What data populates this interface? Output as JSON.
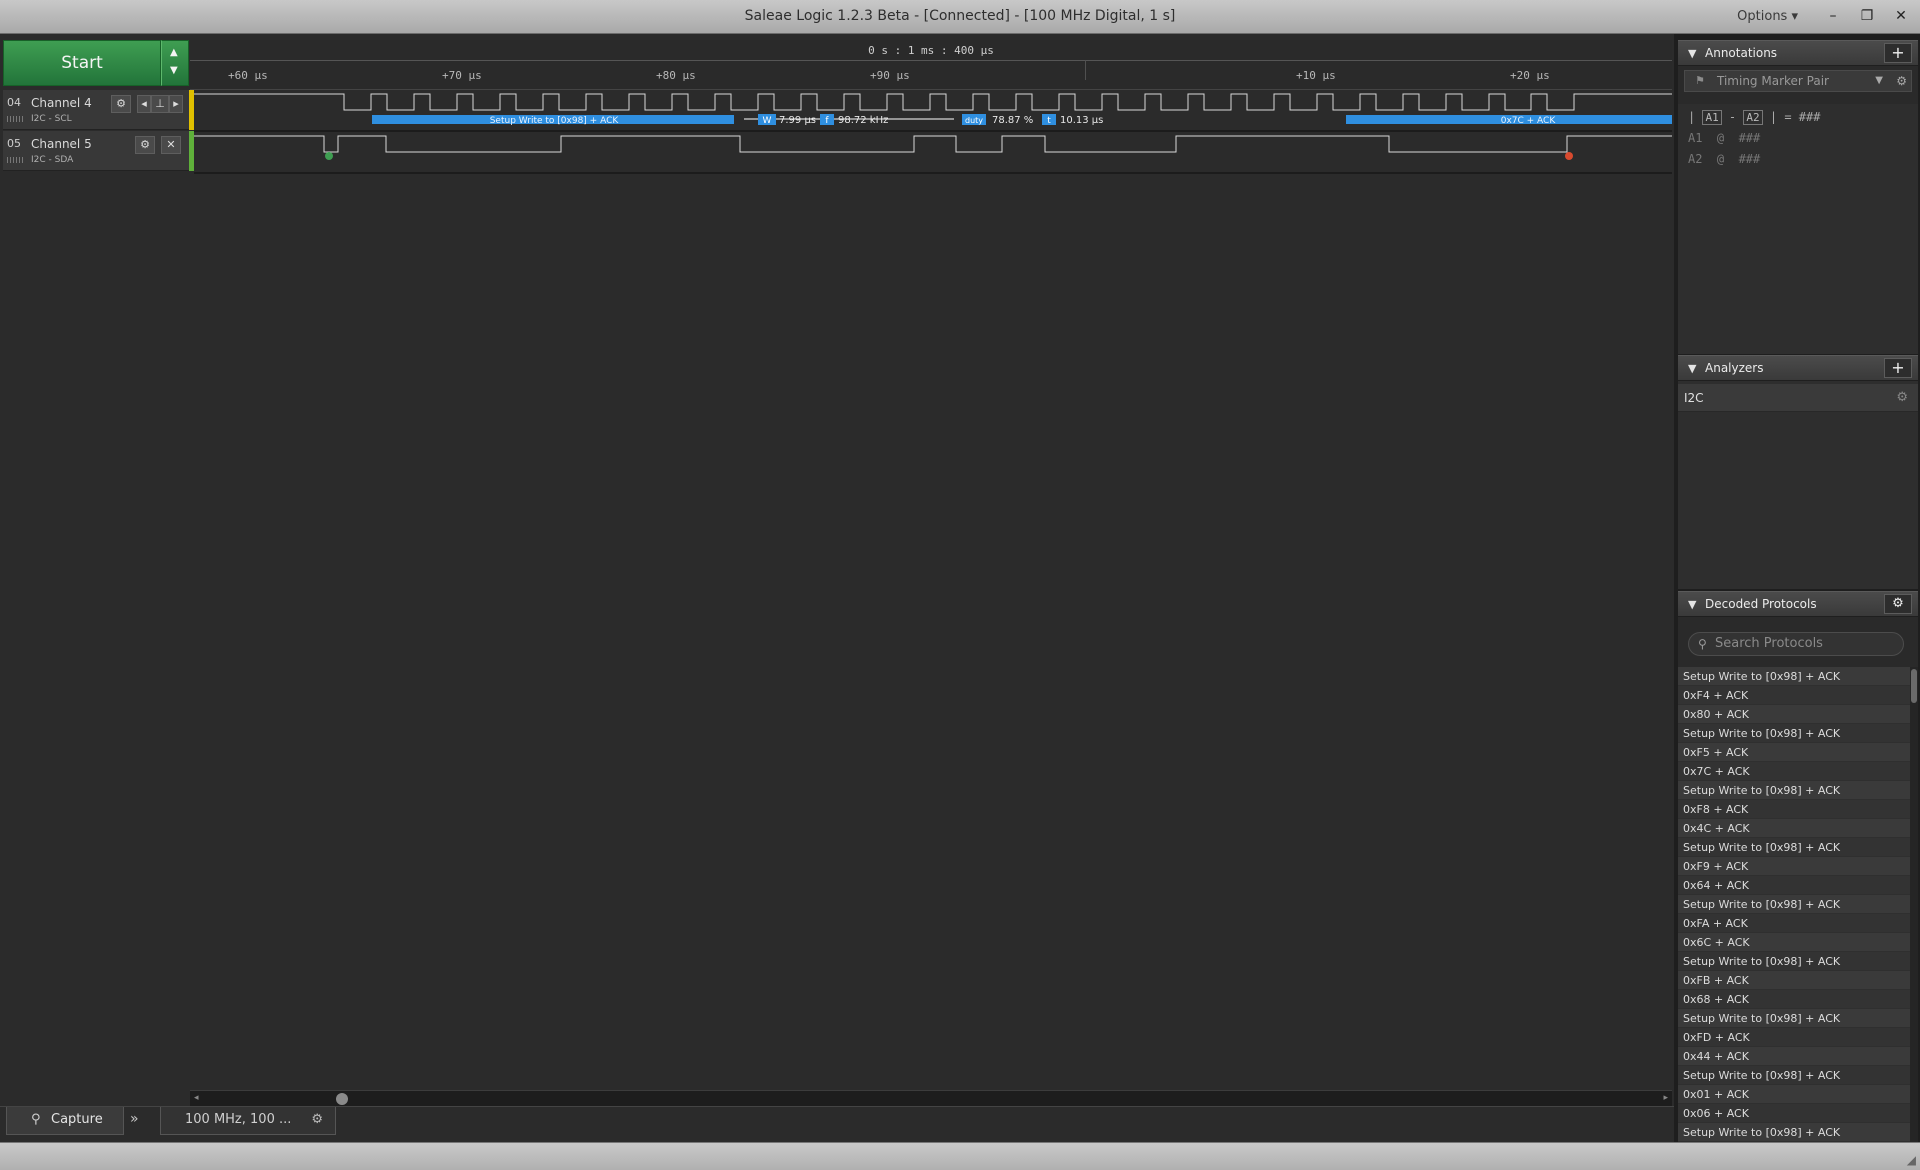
{
  "window": {
    "title": "Saleae Logic 1.2.3 Beta - [Connected] - [100 MHz Digital, 1 s]",
    "options_label": "Options ▾",
    "minimize_glyph": "–",
    "maximize_glyph": "❐",
    "close_glyph": "✕"
  },
  "toolbar": {
    "start_label": "Start",
    "up_glyph": "▲",
    "down_glyph": "▼"
  },
  "timeline": {
    "center_label": "0 s : 1 ms : 400 μs",
    "ticks": [
      "+60 μs",
      "+70 μs",
      "+80 μs",
      "+90 μs",
      "+10 μs",
      "+20 μs"
    ]
  },
  "channels": [
    {
      "num": "04",
      "name": "Channel 4",
      "sub": "I2C - SCL",
      "color": "#e0c000"
    },
    {
      "num": "05",
      "name": "Channel 5",
      "sub": "I2C - SDA",
      "color": "#5fb03a"
    }
  ],
  "measurements": {
    "width_tag": "W",
    "width_value": "7.99 μs",
    "freq_tag": "f",
    "freq_value": "98.72 kHz",
    "duty_tag": "duty",
    "duty_value": "78.87 %",
    "period_tag": "t",
    "period_value": "10.13 μs"
  },
  "decodes": {
    "first": "Setup Write to [0x98] + ACK",
    "second": "0x7C + ACK"
  },
  "bottom": {
    "capture_label": "Capture",
    "rate_label": "100 MHz, 100 ..."
  },
  "panels": {
    "annotations": {
      "title": "Annotations",
      "marker_pair": "Timing Marker Pair",
      "delta_a1": "A1",
      "delta_a2": "A2",
      "delta_value": "= ###",
      "a1_line": "A1  @  ###",
      "a2_line": "A2  @  ###"
    },
    "analyzers": {
      "title": "Analyzers",
      "items": [
        "I2C"
      ]
    },
    "decoded_protocols": {
      "title": "Decoded Protocols",
      "search_placeholder": "Search Protocols",
      "items": [
        "Setup Write to [0x98] + ACK",
        "0xF4 + ACK",
        "0x80 + ACK",
        "Setup Write to [0x98] + ACK",
        "0xF5 + ACK",
        "0x7C + ACK",
        "Setup Write to [0x98] + ACK",
        "0xF8 + ACK",
        "0x4C + ACK",
        "Setup Write to [0x98] + ACK",
        "0xF9 + ACK",
        "0x64 + ACK",
        "Setup Write to [0x98] + ACK",
        "0xFA + ACK",
        "0x6C + ACK",
        "Setup Write to [0x98] + ACK",
        "0xFB + ACK",
        "0x68 + ACK",
        "Setup Write to [0x98] + ACK",
        "0xFD + ACK",
        "0x44 + ACK",
        "Setup Write to [0x98] + ACK",
        "0x01 + ACK",
        "0x06 + ACK",
        "Setup Write to [0x98] + ACK"
      ]
    }
  },
  "colors": {
    "accent_green": "#2d8a45",
    "decode_blue": "#2f8fe0",
    "wave": "#d8d8d8"
  },
  "icons": {
    "gear": "gear-icon",
    "plus": "plus-icon",
    "search": "search-icon",
    "triangle": "collapse-triangle-icon"
  }
}
